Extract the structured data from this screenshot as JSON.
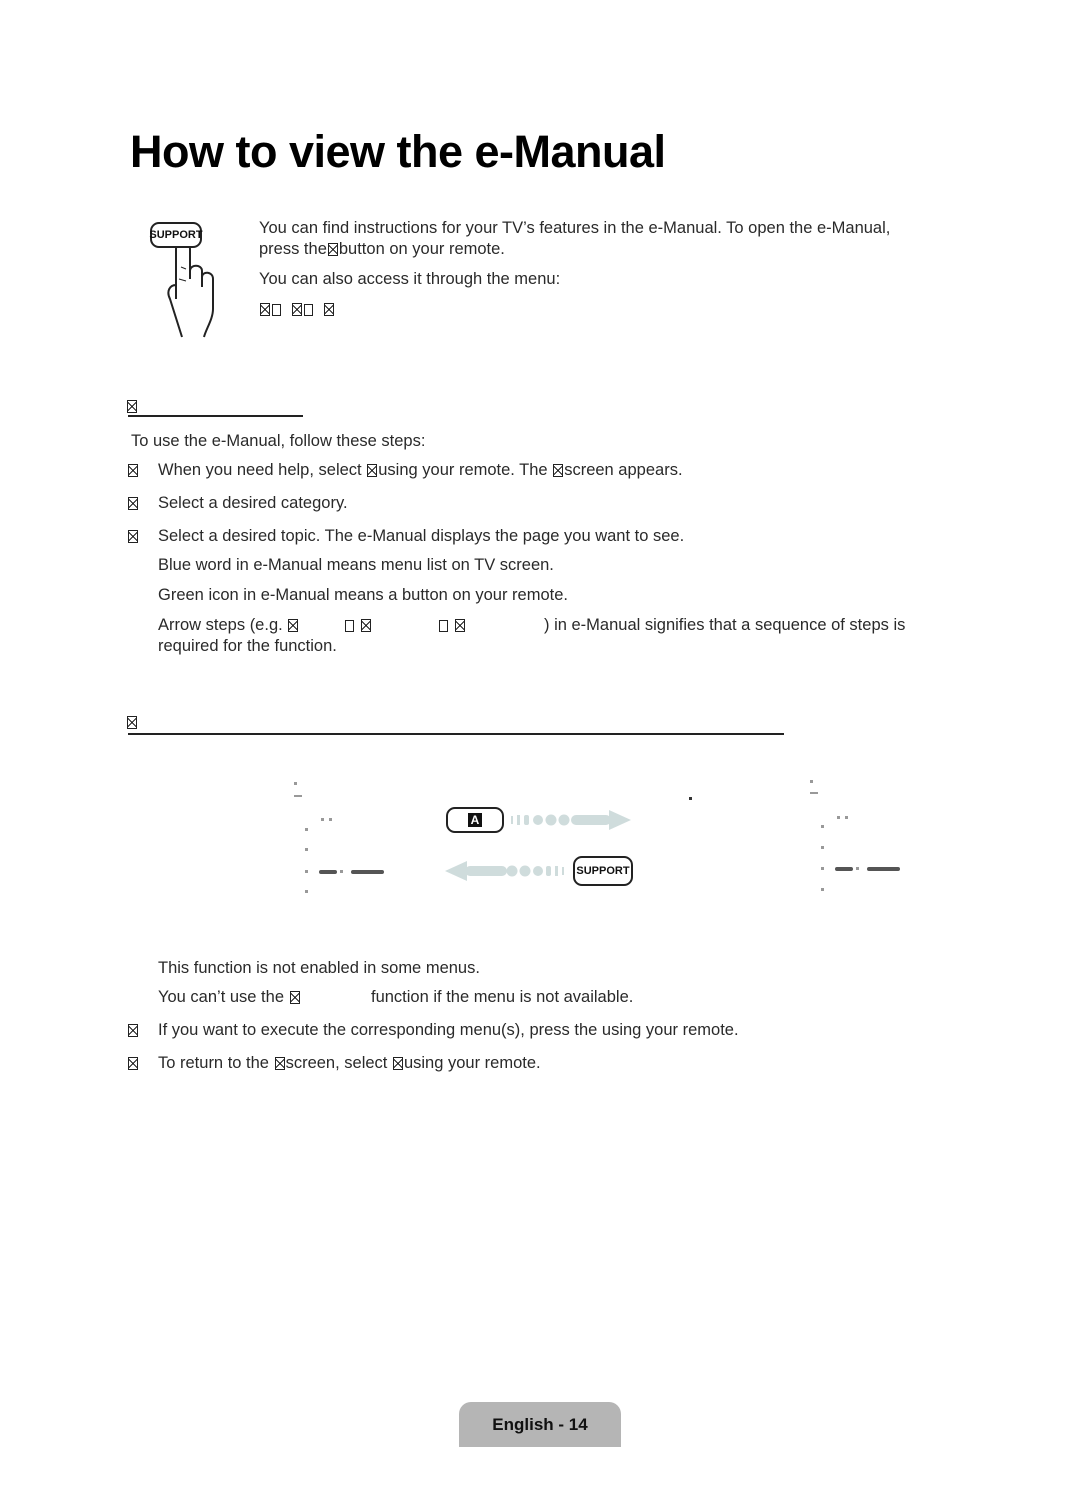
{
  "page": {
    "title": "How to view the e-Manual",
    "footer_label": "English - 14"
  },
  "intro": {
    "remote_button_label": "SUPPORT",
    "line1": "You can find instructions for your TV’s features in the e-Manual. To open the e-Manual,",
    "line2_before": "press the",
    "line2_after": "button on your remote.",
    "line3": "You can also access it through the menu:"
  },
  "section1": {
    "lead": "To use the e-Manual, follow these steps:",
    "steps": [
      {
        "before": "When you need help, select",
        "middle": "using your remote. The",
        "after": "screen appears."
      },
      {
        "text": "Select a desired category."
      },
      {
        "text": "Select a desired topic. The e-Manual displays the page you want to see."
      }
    ],
    "notes": [
      "Blue word in e-Manual means menu list on TV screen.",
      "Green icon in e-Manual means a button on your remote."
    ],
    "arrow_note_before": "Arrow steps (e.g.",
    "arrow_note_after": ") in e-Manual signifies that a sequence of steps is",
    "arrow_note_line2": "required for the function."
  },
  "section2": {
    "diagram": {
      "button_a_label": "A",
      "button_support_label": "SUPPORT",
      "arrow_color": "#cfdcdc"
    },
    "notes": [
      "This function is not enabled in some menus."
    ],
    "note2_before": "You can’t use the",
    "note2_after": "function if the menu is not available.",
    "steps": [
      {
        "text": "If you want to execute the corresponding menu(s), press the  using your remote."
      },
      {
        "before": "To return to the",
        "middle": "screen, select",
        "after": "using your remote."
      }
    ]
  }
}
